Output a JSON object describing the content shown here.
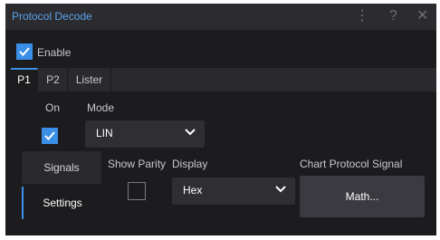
{
  "window": {
    "title": "Protocol Decode",
    "menu_icon": "kebab-menu-icon",
    "help_icon": "help-icon",
    "close_icon": "close-icon"
  },
  "enable": {
    "label": "Enable",
    "checked": true
  },
  "tabs": [
    {
      "label": "P1",
      "active": true
    },
    {
      "label": "P2",
      "active": false
    },
    {
      "label": "Lister",
      "active": false
    }
  ],
  "on": {
    "label": "On",
    "checked": true
  },
  "mode": {
    "label": "Mode",
    "value": "LIN"
  },
  "side_tabs": [
    {
      "label": "Signals",
      "active": false
    },
    {
      "label": "Settings",
      "active": true
    }
  ],
  "show_parity": {
    "label": "Show Parity",
    "checked": false
  },
  "display": {
    "label": "Display",
    "value": "Hex"
  },
  "chart_protocol_signal": {
    "label": "Chart Protocol Signal",
    "button": "Math..."
  },
  "colors": {
    "accent": "#3a8ee6",
    "title": "#5aa2ea",
    "background": "#1c1c1e"
  }
}
